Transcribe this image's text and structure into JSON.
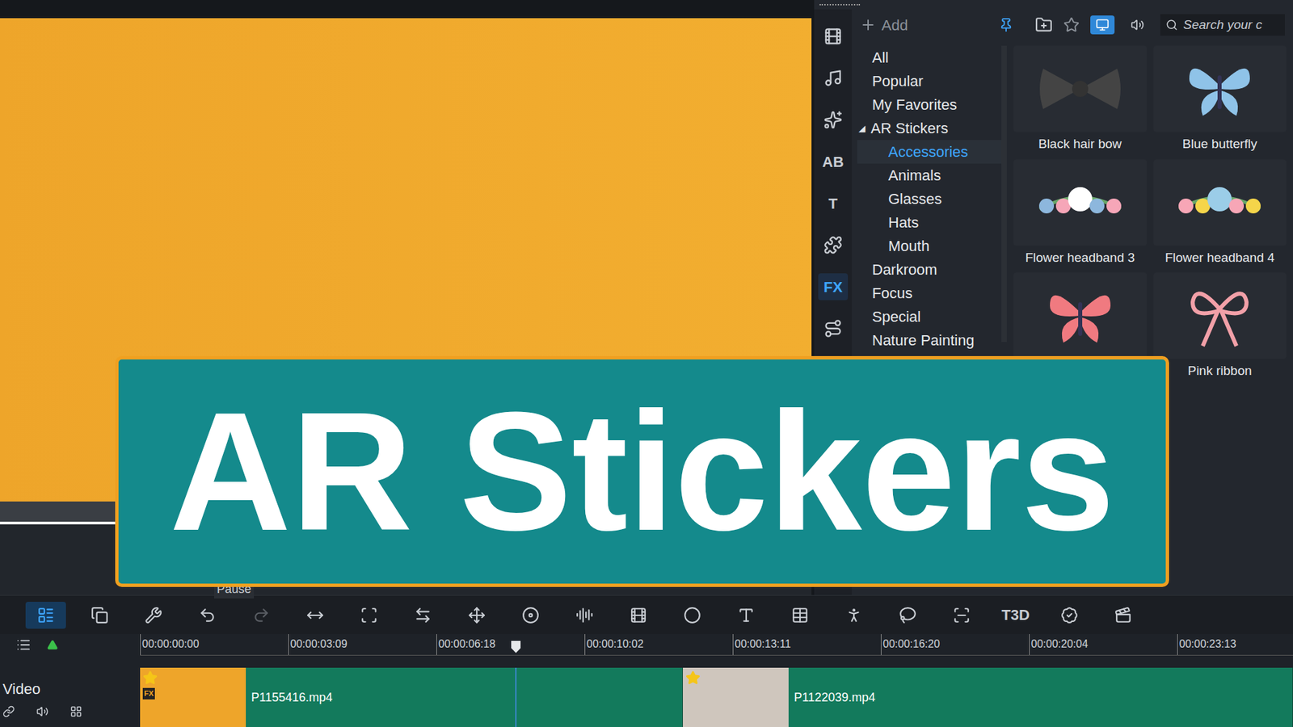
{
  "library": {
    "add_label": "Add",
    "search_placeholder": "Search your c",
    "view_toggles": [
      {
        "selected": true
      },
      {
        "selected": false
      }
    ],
    "side_tabs": [
      {
        "label": "",
        "selected": false
      },
      {
        "label": "",
        "selected": false
      },
      {
        "label": "",
        "selected": false
      },
      {
        "label": "AB",
        "selected": false
      },
      {
        "label": "T",
        "selected": false
      },
      {
        "label": "",
        "selected": false
      },
      {
        "label": "FX",
        "selected": true
      },
      {
        "label": "",
        "selected": false
      }
    ],
    "categories": [
      {
        "label": "All",
        "level": 0,
        "selected": false
      },
      {
        "label": "Popular",
        "level": 0,
        "selected": false
      },
      {
        "label": "My Favorites",
        "level": 0,
        "selected": false
      },
      {
        "label": "AR Stickers",
        "level": 0,
        "selected": false,
        "expanded": true
      },
      {
        "label": "Accessories",
        "level": 1,
        "selected": true
      },
      {
        "label": "Animals",
        "level": 1,
        "selected": false
      },
      {
        "label": "Glasses",
        "level": 1,
        "selected": false
      },
      {
        "label": "Hats",
        "level": 1,
        "selected": false
      },
      {
        "label": "Mouth",
        "level": 1,
        "selected": false
      },
      {
        "label": "Darkroom",
        "level": 0,
        "selected": false
      },
      {
        "label": "Focus",
        "level": 0,
        "selected": false
      },
      {
        "label": "Special",
        "level": 0,
        "selected": false
      },
      {
        "label": "Nature Painting",
        "level": 0,
        "selected": false
      }
    ],
    "stickers": [
      {
        "label": "Black hair bow"
      },
      {
        "label": "Blue butterfly"
      },
      {
        "label": "Flower headband 3"
      },
      {
        "label": "Flower headband 4"
      },
      {
        "label": ""
      },
      {
        "label": "Pink ribbon"
      }
    ]
  },
  "banner": {
    "text": "AR Stickers"
  },
  "tooltip": {
    "text": "Pause"
  },
  "toolbar": {
    "buttons": [
      {
        "label": "",
        "selected": true,
        "disabled": false
      },
      {
        "label": "",
        "selected": false,
        "disabled": false
      },
      {
        "label": "",
        "selected": false,
        "disabled": false
      },
      {
        "label": "",
        "selected": false,
        "disabled": false
      },
      {
        "label": "",
        "selected": false,
        "disabled": true
      },
      {
        "label": "",
        "selected": false,
        "disabled": false
      },
      {
        "label": "",
        "selected": false,
        "disabled": false
      },
      {
        "label": "",
        "selected": false,
        "disabled": false
      },
      {
        "label": "",
        "selected": false,
        "disabled": false
      },
      {
        "label": "",
        "selected": false,
        "disabled": false
      },
      {
        "label": "",
        "selected": false,
        "disabled": false
      },
      {
        "label": "",
        "selected": false,
        "disabled": false
      },
      {
        "label": "",
        "selected": false,
        "disabled": false
      },
      {
        "label": "",
        "selected": false,
        "disabled": false
      },
      {
        "label": "",
        "selected": false,
        "disabled": false
      },
      {
        "label": "",
        "selected": false,
        "disabled": false
      },
      {
        "label": "",
        "selected": false,
        "disabled": false
      },
      {
        "label": "",
        "selected": false,
        "disabled": false
      },
      {
        "label": "T3D",
        "selected": false,
        "disabled": false
      },
      {
        "label": "",
        "selected": false,
        "disabled": false
      },
      {
        "label": "",
        "selected": false,
        "disabled": false
      }
    ]
  },
  "timeline": {
    "ticks": [
      "00:00:00:00",
      "00:00:03:09",
      "00:00:06:18",
      "00:00:10:02",
      "00:00:13:11",
      "00:00:16:20",
      "00:00:20:04",
      "00:00:23:13"
    ],
    "playhead": {
      "level": 0.326
    },
    "track": {
      "label": "Video",
      "clips": [
        {
          "name": "P1155416.mp4",
          "badges": [
            "FX"
          ]
        },
        {
          "name": "P1122039.mp4",
          "badges": []
        }
      ]
    }
  }
}
